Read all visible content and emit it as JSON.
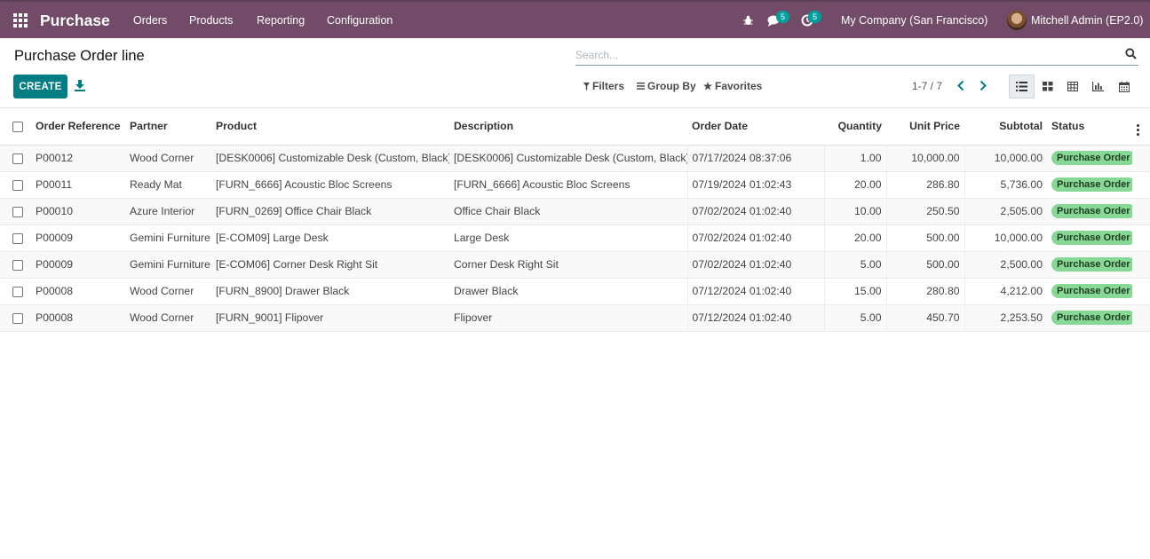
{
  "navbar": {
    "app_name": "Purchase",
    "menu": [
      "Orders",
      "Products",
      "Reporting",
      "Configuration"
    ],
    "messages_count": "5",
    "activities_count": "5",
    "company": "My Company (San Francisco)",
    "user": "Mitchell Admin (EP2.0)"
  },
  "control": {
    "title": "Purchase Order line",
    "search_placeholder": "Search...",
    "create_label": "CREATE",
    "filters_label": "Filters",
    "groupby_label": "Group By",
    "favorites_label": "Favorites",
    "pager": "1-7 / 7"
  },
  "table": {
    "columns": [
      "Order Reference",
      "Partner",
      "Product",
      "Description",
      "Order Date",
      "Quantity",
      "Unit Price",
      "Subtotal",
      "Status"
    ],
    "rows": [
      {
        "ref": "P00012",
        "partner": "Wood Corner",
        "product": "[DESK0006] Customizable Desk (Custom, Black)",
        "description": "[DESK0006] Customizable Desk (Custom, Black)",
        "date": "07/17/2024 08:37:06",
        "qty": "1.00",
        "price": "10,000.00",
        "subtotal": "10,000.00",
        "status": "Purchase Order"
      },
      {
        "ref": "P00011",
        "partner": "Ready Mat",
        "product": "[FURN_6666] Acoustic Bloc Screens",
        "description": "[FURN_6666] Acoustic Bloc Screens",
        "date": "07/19/2024 01:02:43",
        "qty": "20.00",
        "price": "286.80",
        "subtotal": "5,736.00",
        "status": "Purchase Order"
      },
      {
        "ref": "P00010",
        "partner": "Azure Interior",
        "product": "[FURN_0269] Office Chair Black",
        "description": "Office Chair Black",
        "date": "07/02/2024 01:02:40",
        "qty": "10.00",
        "price": "250.50",
        "subtotal": "2,505.00",
        "status": "Purchase Order"
      },
      {
        "ref": "P00009",
        "partner": "Gemini Furniture",
        "product": "[E-COM09] Large Desk",
        "description": "Large Desk",
        "date": "07/02/2024 01:02:40",
        "qty": "20.00",
        "price": "500.00",
        "subtotal": "10,000.00",
        "status": "Purchase Order"
      },
      {
        "ref": "P00009",
        "partner": "Gemini Furniture",
        "product": "[E-COM06] Corner Desk Right Sit",
        "description": "Corner Desk Right Sit",
        "date": "07/02/2024 01:02:40",
        "qty": "5.00",
        "price": "500.00",
        "subtotal": "2,500.00",
        "status": "Purchase Order"
      },
      {
        "ref": "P00008",
        "partner": "Wood Corner",
        "product": "[FURN_8900] Drawer Black",
        "description": "Drawer Black",
        "date": "07/12/2024 01:02:40",
        "qty": "15.00",
        "price": "280.80",
        "subtotal": "4,212.00",
        "status": "Purchase Order"
      },
      {
        "ref": "P00008",
        "partner": "Wood Corner",
        "product": "[FURN_9001] Flipover",
        "description": "Flipover",
        "date": "07/12/2024 01:02:40",
        "qty": "5.00",
        "price": "450.70",
        "subtotal": "2,253.50",
        "status": "Purchase Order"
      }
    ]
  },
  "colors": {
    "navbar": "#714b67",
    "primary": "#017e84",
    "status_badge": "#88d895",
    "badge": "#00a09d"
  }
}
